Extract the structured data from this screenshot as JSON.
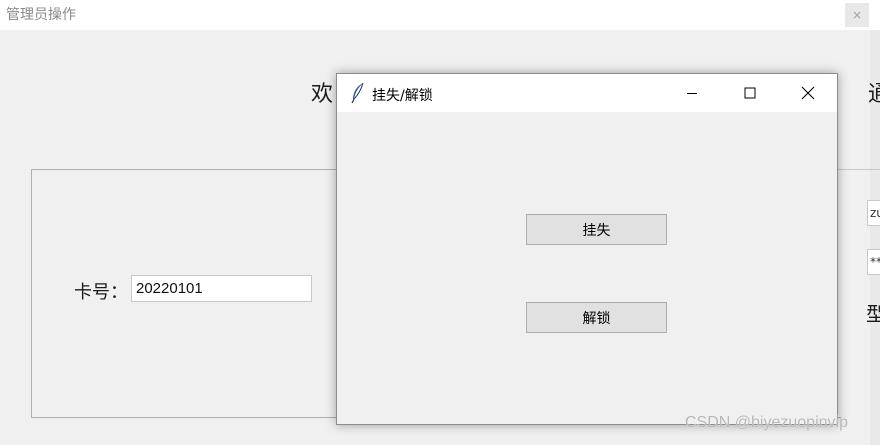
{
  "background_window": {
    "title": "管理员操作",
    "close_label": "×",
    "welcome_text": "欢",
    "right_edge_glyph": "通",
    "card_label": "卡号：",
    "card_value": "20220101",
    "edge_field_1": "zu",
    "edge_field_2": "**",
    "edge_glyph_2": "型"
  },
  "dialog": {
    "title": "挂失/解锁",
    "icon": "feather-icon",
    "report_loss_label": "挂失",
    "unlock_label": "解锁"
  },
  "watermark": "CSDN @biyezuopinvip"
}
